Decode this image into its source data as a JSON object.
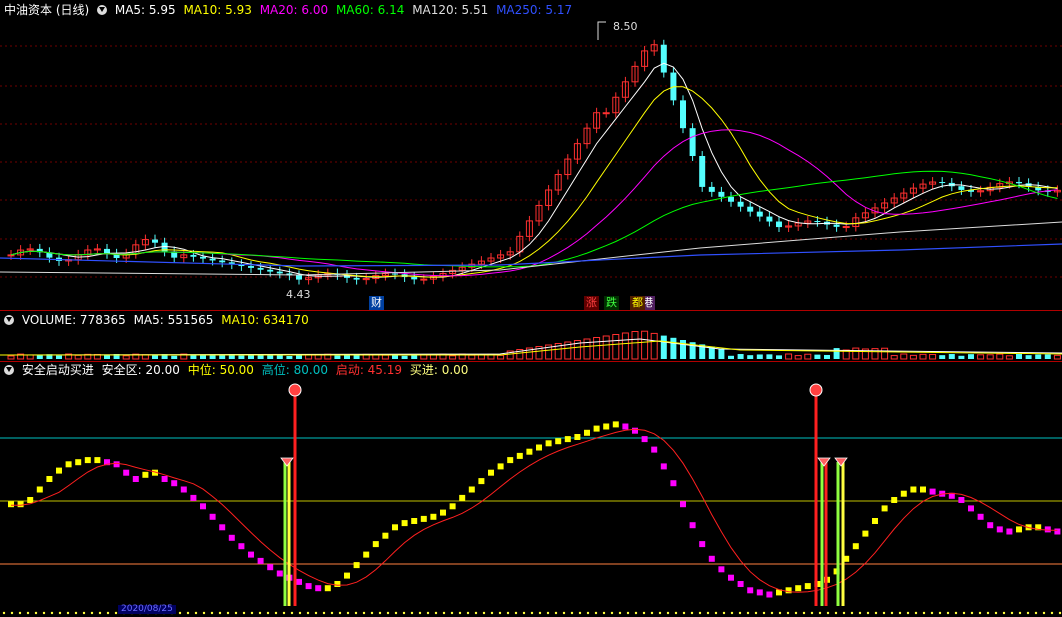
{
  "price_panel": {
    "title": "中油资本 (日线)",
    "indicators": [
      {
        "label": "MA5: 5.95",
        "color": "#ffffff"
      },
      {
        "label": "MA10: 5.93",
        "color": "#ffff00"
      },
      {
        "label": "MA20: 6.00",
        "color": "#ff00ff"
      },
      {
        "label": "MA60: 6.14",
        "color": "#00ff00"
      },
      {
        "label": "MA120: 5.51",
        "color": "#dddddd"
      },
      {
        "label": "MA250: 5.17",
        "color": "#3050ff"
      }
    ],
    "high_label": "8.50",
    "low_label": "4.43",
    "markers": [
      {
        "text": "财",
        "color": "#ffffff",
        "bg": "#0040a0"
      },
      {
        "text": "涨",
        "color": "#ff4040",
        "bg": "#600000"
      },
      {
        "text": "跌",
        "color": "#40ff40",
        "bg": "#003000"
      },
      {
        "text": "港",
        "color": "#ffffff",
        "bg": "#502060"
      },
      {
        "text": "都",
        "color": "#ffff00",
        "bg": "#502000"
      }
    ]
  },
  "volume_panel": {
    "title": "VOLUME: 778365",
    "ma5": "MA5: 551565",
    "ma10": "MA10: 634170"
  },
  "indicator_panel": {
    "title": "安全启动买进",
    "items": [
      {
        "label": "安全区: 20.00",
        "color": "#ffffff"
      },
      {
        "label": "中位: 50.00",
        "color": "#ffff00"
      },
      {
        "label": "高位: 80.00",
        "color": "#00c0c0"
      },
      {
        "label": "启动: 45.19",
        "color": "#ff3030"
      },
      {
        "label": "买进: 0.00",
        "color": "#ffff80"
      }
    ]
  },
  "axis": {
    "date_label": "2020/08/25"
  },
  "chart_data": {
    "type": "line",
    "title": "中油资本 (日线)",
    "price_high": 8.5,
    "price_low": 4.43,
    "moving_averages": {
      "MA5": 5.95,
      "MA10": 5.93,
      "MA20": 6.0,
      "MA60": 6.14,
      "MA120": 5.51,
      "MA250": 5.17
    },
    "volume": {
      "VOLUME": 778365,
      "MA5": 551565,
      "MA10": 634170
    },
    "oscillator": {
      "levels": {
        "安全区": 20.0,
        "中位": 50.0,
        "高位": 80.0
      },
      "启动": 45.19,
      "买进": 0.0,
      "series": [
        48,
        48,
        50,
        55,
        60,
        64,
        67,
        68,
        69,
        69,
        68,
        67,
        63,
        60,
        62,
        63,
        60,
        58,
        55,
        51,
        47,
        42,
        37,
        32,
        28,
        24,
        21,
        18,
        15,
        13,
        11,
        9,
        8,
        8,
        10,
        14,
        19,
        24,
        29,
        33,
        37,
        39,
        40,
        41,
        42,
        44,
        47,
        51,
        55,
        59,
        63,
        66,
        69,
        71,
        73,
        75,
        77,
        78,
        79,
        80,
        82,
        84,
        85,
        86,
        85,
        83,
        79,
        74,
        66,
        58,
        48,
        38,
        29,
        22,
        17,
        13,
        10,
        7,
        6,
        5,
        6,
        7,
        8,
        9,
        10,
        12,
        16,
        22,
        28,
        34,
        40,
        46,
        50,
        53,
        55,
        55,
        54,
        53,
        52,
        50,
        46,
        42,
        38,
        36,
        35,
        36,
        37,
        37,
        36,
        35
      ]
    }
  }
}
